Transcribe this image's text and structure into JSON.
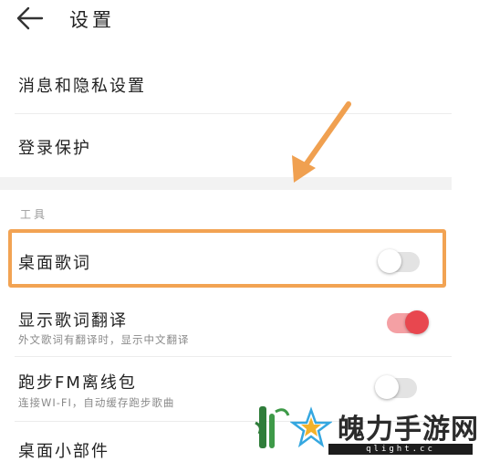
{
  "header": {
    "title": "设置",
    "back_icon": "arrow-left-icon"
  },
  "settings": {
    "privacy": {
      "label": "消息和隐私设置"
    },
    "login_protection": {
      "label": "登录保护"
    }
  },
  "tools": {
    "section_title": "工具",
    "items": [
      {
        "label": "桌面歌词",
        "subtitle": "",
        "toggle": false
      },
      {
        "label": "显示歌词翻译",
        "subtitle": "外文歌词有翻译时，显示中文翻译",
        "toggle": true
      },
      {
        "label": "跑步FM离线包",
        "subtitle": "连接WI-FI，自动缓存跑步歌曲",
        "toggle": false
      },
      {
        "label": "桌面小部件",
        "subtitle": "",
        "toggle": null
      }
    ]
  },
  "annotation": {
    "arrow_color": "#f0a050",
    "highlight_color": "#f2a353"
  },
  "colors": {
    "accent": "#e8474f",
    "toggle_on_track": "#f4a0a4",
    "toggle_off_track": "#e3e3e3"
  },
  "watermark": {
    "brand": "魄力手游网",
    "domain": "qlight.cc"
  }
}
